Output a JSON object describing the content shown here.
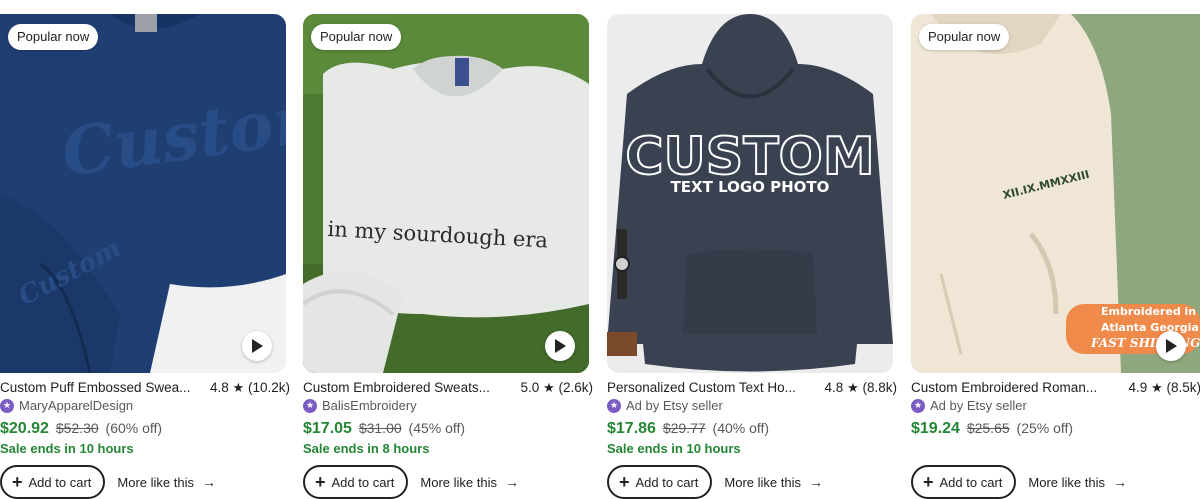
{
  "listings": [
    {
      "badge": "Popular now",
      "image_text": {
        "main": "Custom",
        "sleeve": "Custom"
      },
      "title": "Custom Puff Embossed Swea...",
      "rating": "4.8",
      "reviews": "(10.2k)",
      "seller": "MaryApparelDesign",
      "price": "$20.92",
      "original_price": "$52.30",
      "discount": "(60% off)",
      "sale_ends": "Sale ends in 10 hours",
      "add_to_cart": "Add to cart",
      "more_like_this": "More like this",
      "has_play": true
    },
    {
      "badge": "Popular now",
      "image_text": {
        "main": "in my sourdough era"
      },
      "title": "Custom Embroidered Sweats...",
      "rating": "5.0",
      "reviews": "(2.6k)",
      "seller": "BalisEmbroidery",
      "price": "$17.05",
      "original_price": "$31.00",
      "discount": "(45% off)",
      "sale_ends": "Sale ends in 8 hours",
      "add_to_cart": "Add to cart",
      "more_like_this": "More like this",
      "has_play": true
    },
    {
      "badge": "",
      "image_text": {
        "main": "CUSTOM",
        "sub": "TEXT LOGO PHOTO"
      },
      "title": "Personalized Custom Text Ho...",
      "rating": "4.8",
      "reviews": "(8.8k)",
      "seller": "Ad by Etsy seller",
      "price": "$17.86",
      "original_price": "$29.77",
      "discount": "(40% off)",
      "sale_ends": "Sale ends in 10 hours",
      "add_to_cart": "Add to cart",
      "more_like_this": "More like this",
      "has_play": false
    },
    {
      "badge": "Popular now",
      "image_text": {
        "main": "XII.IX.MMXXIII",
        "banner1": "Embroidered in",
        "banner2": "Atlanta Georgia",
        "banner3": "FAST SHIPPING"
      },
      "title": "Custom Embroidered Roman...",
      "rating": "4.9",
      "reviews": "(8.5k)",
      "seller": "Ad by Etsy seller",
      "price": "$19.24",
      "original_price": "$25.65",
      "discount": "(25% off)",
      "sale_ends": "",
      "add_to_cart": "Add to cart",
      "more_like_this": "More like this",
      "has_play": true
    }
  ],
  "icons": {
    "star": "star-icon",
    "seller_badge": "star-seller-icon",
    "play": "play-icon",
    "plus": "plus-icon",
    "arrow": "arrow-right-icon"
  },
  "colors": {
    "sale_green": "#258635",
    "seller_badge_purple": "#7b5dc4",
    "text": "#222222",
    "muted": "#595959"
  }
}
